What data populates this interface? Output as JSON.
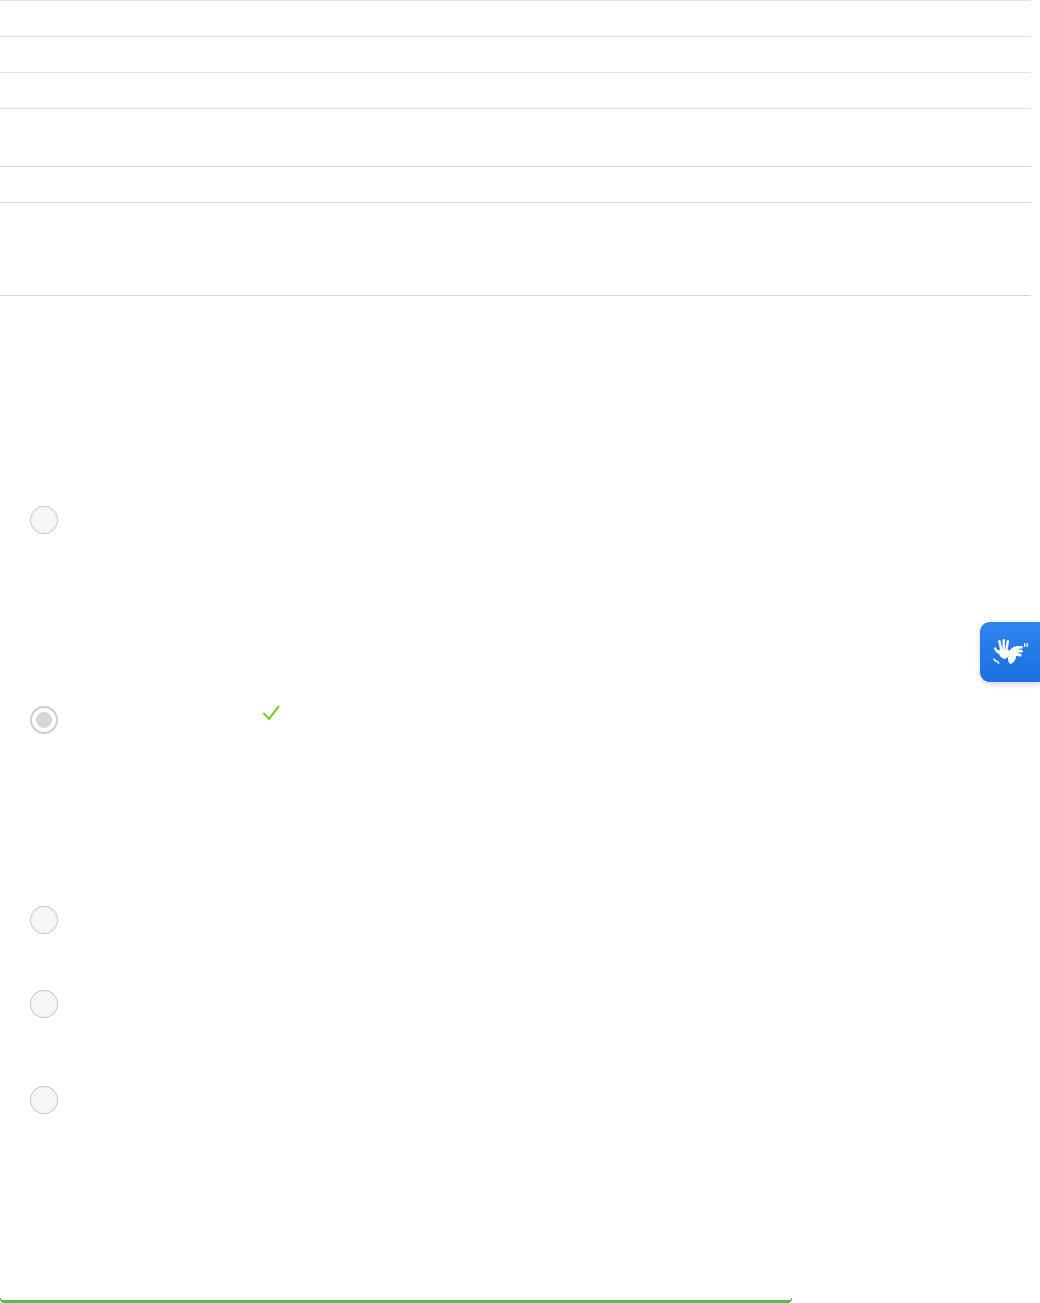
{
  "table": {
    "rows": [
      "",
      "",
      "",
      "",
      "",
      ""
    ]
  },
  "question": {
    "options": [
      {
        "label": "",
        "selected": false
      },
      {
        "label": "",
        "selected": true,
        "correct": true
      },
      {
        "label": "",
        "selected": false
      },
      {
        "label": "",
        "selected": false
      },
      {
        "label": "",
        "selected": false
      }
    ]
  },
  "accessibility_button": {
    "icon": "sign-language-icon",
    "background": "#1b6fe0"
  },
  "progress": {
    "color": "#5cb85c"
  },
  "colors": {
    "correct_check": "#7cc51c"
  }
}
